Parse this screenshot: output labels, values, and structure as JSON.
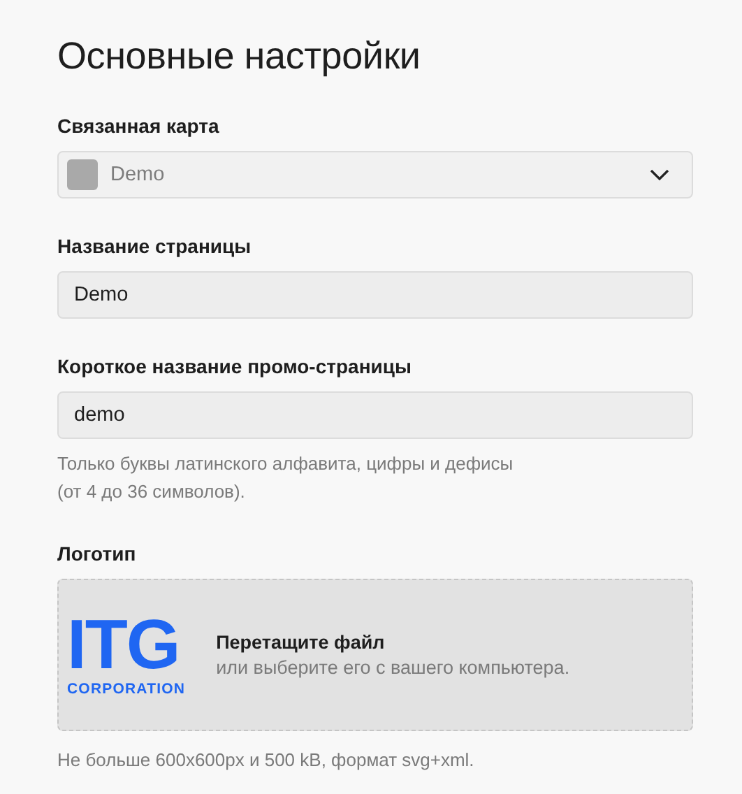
{
  "title": "Основные настройки",
  "fields": [
    {
      "kind": "select",
      "label": "Связанная карта",
      "value": "Demo",
      "disabled": true
    },
    {
      "kind": "input",
      "label": "Название страницы",
      "value": "Demo"
    },
    {
      "kind": "input",
      "label": "Короткое название промо-страницы",
      "value": "demo",
      "hint": "Только буквы латинского алфавита, цифры и дефисы\n(от 4 до 36 символов)."
    },
    {
      "kind": "upload",
      "label": "Логотип",
      "logo": {
        "mark": "ITG",
        "subtitle": "CORPORATION"
      },
      "drop_title": "Перетащите файл",
      "drop_text": "или выберите его с вашего компьютера.",
      "hint": "Не больше 600x600px и 500 kB, формат svg+xml."
    }
  ]
}
